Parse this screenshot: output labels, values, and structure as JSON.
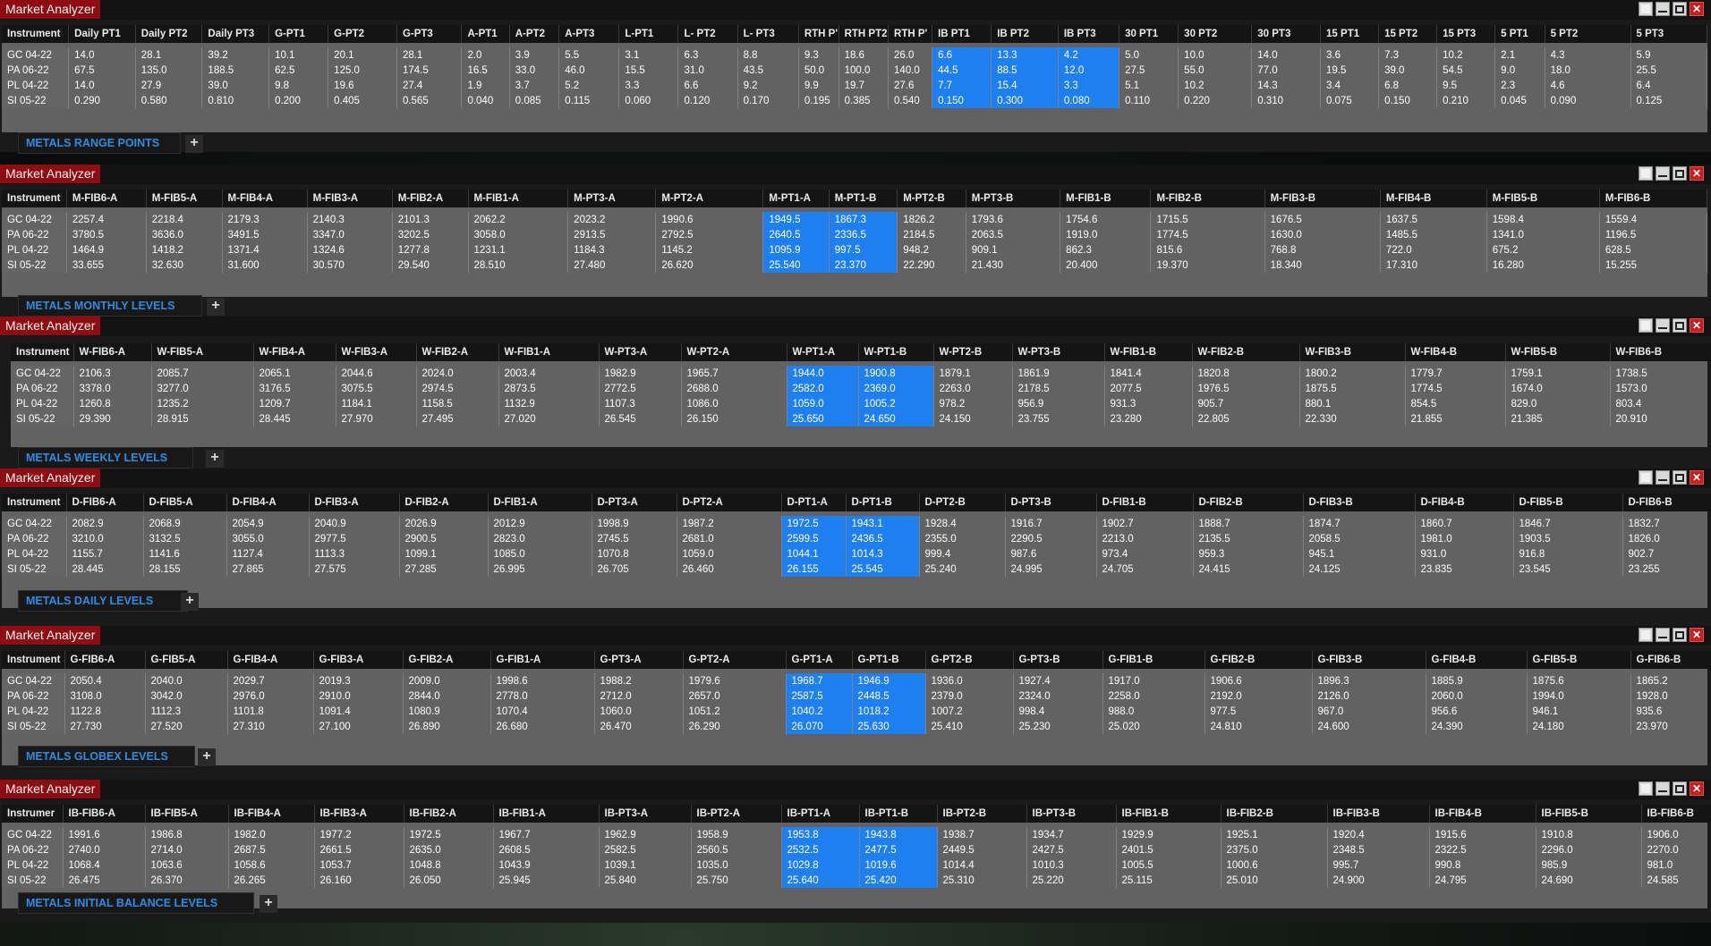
{
  "window_title": "Market Analyzer",
  "add_tab_label": "+",
  "instruments": [
    "GC 04-22",
    "PA 06-22",
    "PL 04-22",
    "SI 05-22"
  ],
  "panels": [
    {
      "tab": "METALS RANGE POINTS",
      "instrument_header": "Instrument",
      "columns": [
        "Daily PT1",
        "Daily PT2",
        "Daily PT3",
        "G-PT1",
        "G-PT2",
        "G-PT3",
        "A-PT1",
        "A-PT2",
        "A-PT3",
        "L-PT1",
        "L- PT2",
        "L- PT3",
        "RTH P'",
        "RTH PT2",
        "RTH P'",
        "IB PT1",
        "IB PT2",
        "IB PT3",
        "30 PT1",
        "30 PT2",
        "30 PT3",
        "15 PT1",
        "15 PT2",
        "15 PT3",
        "5 PT1",
        "5 PT2",
        "5 PT3"
      ],
      "highlight": [
        15,
        16,
        17
      ],
      "rows": [
        [
          "14.0",
          "28.1",
          "39.2",
          "10.1",
          "20.1",
          "28.1",
          "2.0",
          "3.9",
          "5.5",
          "3.1",
          "6.3",
          "8.8",
          "9.3",
          "18.6",
          "26.0",
          "6.6",
          "13.3",
          "4.2",
          "5.0",
          "10.0",
          "14.0",
          "3.6",
          "7.3",
          "10.2",
          "2.1",
          "4.3",
          "5.9"
        ],
        [
          "67.5",
          "135.0",
          "188.5",
          "62.5",
          "125.0",
          "174.5",
          "16.5",
          "33.0",
          "46.0",
          "15.5",
          "31.0",
          "43.5",
          "50.0",
          "100.0",
          "140.0",
          "44.5",
          "88.5",
          "12.0",
          "27.5",
          "55.0",
          "77.0",
          "19.5",
          "39.0",
          "54.5",
          "9.0",
          "18.0",
          "25.5"
        ],
        [
          "14.0",
          "27.9",
          "39.0",
          "9.8",
          "19.6",
          "27.4",
          "1.9",
          "3.7",
          "5.2",
          "3.3",
          "6.6",
          "9.2",
          "9.9",
          "19.7",
          "27.6",
          "7.7",
          "15.4",
          "3.3",
          "5.1",
          "10.2",
          "14.3",
          "3.4",
          "6.8",
          "9.5",
          "2.3",
          "4.6",
          "6.4"
        ],
        [
          "0.290",
          "0.580",
          "0.810",
          "0.200",
          "0.405",
          "0.565",
          "0.040",
          "0.085",
          "0.115",
          "0.060",
          "0.120",
          "0.170",
          "0.195",
          "0.385",
          "0.540",
          "0.150",
          "0.300",
          "0.080",
          "0.110",
          "0.220",
          "0.310",
          "0.075",
          "0.150",
          "0.210",
          "0.045",
          "0.090",
          "0.125"
        ]
      ]
    },
    {
      "tab": "METALS MONTHLY LEVELS",
      "instrument_header": "Instrument",
      "columns": [
        "M-FIB6-A",
        "M-FIB5-A",
        "M-FIB4-A",
        "M-FIB3-A",
        "M-FIB2-A",
        "M-FIB1-A",
        "M-PT3-A",
        "M-PT2-A",
        "M-PT1-A",
        "M-PT1-B",
        "M-PT2-B",
        "M-PT3-B",
        "M-FIB1-B",
        "M-FIB2-B",
        "M-FIB3-B",
        "M-FIB4-B",
        "M-FIB5-B",
        "M-FIB6-B"
      ],
      "highlight": [
        8,
        9
      ],
      "rows": [
        [
          "2257.4",
          "2218.4",
          "2179.3",
          "2140.3",
          "2101.3",
          "2062.2",
          "2023.2",
          "1990.6",
          "1949.5",
          "1867.3",
          "1826.2",
          "1793.6",
          "1754.6",
          "1715.5",
          "1676.5",
          "1637.5",
          "1598.4",
          "1559.4"
        ],
        [
          "3780.5",
          "3636.0",
          "3491.5",
          "3347.0",
          "3202.5",
          "3058.0",
          "2913.5",
          "2792.5",
          "2640.5",
          "2336.5",
          "2184.5",
          "2063.5",
          "1919.0",
          "1774.5",
          "1630.0",
          "1485.5",
          "1341.0",
          "1196.5"
        ],
        [
          "1464.9",
          "1418.2",
          "1371.4",
          "1324.6",
          "1277.8",
          "1231.1",
          "1184.3",
          "1145.2",
          "1095.9",
          "997.5",
          "948.2",
          "909.1",
          "862.3",
          "815.6",
          "768.8",
          "722.0",
          "675.2",
          "628.5"
        ],
        [
          "33.655",
          "32.630",
          "31.600",
          "30.570",
          "29.540",
          "28.510",
          "27.480",
          "26.620",
          "25.540",
          "23.370",
          "22.290",
          "21.430",
          "20.400",
          "19.370",
          "18.340",
          "17.310",
          "16.280",
          "15.255"
        ]
      ]
    },
    {
      "tab": "METALS WEEKLY LEVELS",
      "instrument_header": "Instrument",
      "columns": [
        "W-FIB6-A",
        "W-FIB5-A",
        "W-FIB4-A",
        "W-FIB3-A",
        "W-FIB2-A",
        "W-FIB1-A",
        "W-PT3-A",
        "W-PT2-A",
        "W-PT1-A",
        "W-PT1-B",
        "W-PT2-B",
        "W-PT3-B",
        "W-FIB1-B",
        "W-FIB2-B",
        "W-FIB3-B",
        "W-FIB4-B",
        "W-FIB5-B",
        "W-FIB6-B"
      ],
      "highlight": [
        8,
        9
      ],
      "rows": [
        [
          "2106.3",
          "2085.7",
          "2065.1",
          "2044.6",
          "2024.0",
          "2003.4",
          "1982.9",
          "1965.7",
          "1944.0",
          "1900.8",
          "1879.1",
          "1861.9",
          "1841.4",
          "1820.8",
          "1800.2",
          "1779.7",
          "1759.1",
          "1738.5"
        ],
        [
          "3378.0",
          "3277.0",
          "3176.5",
          "3075.5",
          "2974.5",
          "2873.5",
          "2772.5",
          "2688.0",
          "2582.0",
          "2369.0",
          "2263.0",
          "2178.5",
          "2077.5",
          "1976.5",
          "1875.5",
          "1774.5",
          "1674.0",
          "1573.0"
        ],
        [
          "1260.8",
          "1235.2",
          "1209.7",
          "1184.1",
          "1158.5",
          "1132.9",
          "1107.3",
          "1086.0",
          "1059.0",
          "1005.2",
          "978.2",
          "956.9",
          "931.3",
          "905.7",
          "880.1",
          "854.5",
          "829.0",
          "803.4"
        ],
        [
          "29.390",
          "28.915",
          "28.445",
          "27.970",
          "27.495",
          "27.020",
          "26.545",
          "26.150",
          "25.650",
          "24.650",
          "24.150",
          "23.755",
          "23.280",
          "22.805",
          "22.330",
          "21.855",
          "21.385",
          "20.910"
        ]
      ]
    },
    {
      "tab": "METALS DAILY LEVELS",
      "instrument_header": "Instrument",
      "columns": [
        "D-FIB6-A",
        "D-FIB5-A",
        "D-FIB4-A",
        "D-FIB3-A",
        "D-FIB2-A",
        "D-FIB1-A",
        "D-PT3-A",
        "D-PT2-A",
        "D-PT1-A",
        "D-PT1-B",
        "D-PT2-B",
        "D-PT3-B",
        "D-FIB1-B",
        "D-FIB2-B",
        "D-FIB3-B",
        "D-FIB4-B",
        "D-FIB5-B",
        "D-FIB6-B"
      ],
      "highlight": [
        8,
        9
      ],
      "rows": [
        [
          "2082.9",
          "2068.9",
          "2054.9",
          "2040.9",
          "2026.9",
          "2012.9",
          "1998.9",
          "1987.2",
          "1972.5",
          "1943.1",
          "1928.4",
          "1916.7",
          "1902.7",
          "1888.7",
          "1874.7",
          "1860.7",
          "1846.7",
          "1832.7"
        ],
        [
          "3210.0",
          "3132.5",
          "3055.0",
          "2977.5",
          "2900.5",
          "2823.0",
          "2745.5",
          "2681.0",
          "2599.5",
          "2436.5",
          "2355.0",
          "2290.5",
          "2213.0",
          "2135.5",
          "2058.5",
          "1981.0",
          "1903.5",
          "1826.0"
        ],
        [
          "1155.7",
          "1141.6",
          "1127.4",
          "1113.3",
          "1099.1",
          "1085.0",
          "1070.8",
          "1059.0",
          "1044.1",
          "1014.3",
          "999.4",
          "987.6",
          "973.4",
          "959.3",
          "945.1",
          "931.0",
          "916.8",
          "902.7"
        ],
        [
          "28.445",
          "28.155",
          "27.865",
          "27.575",
          "27.285",
          "26.995",
          "26.705",
          "26.460",
          "26.155",
          "25.545",
          "25.240",
          "24.995",
          "24.705",
          "24.415",
          "24.125",
          "23.835",
          "23.545",
          "23.255"
        ]
      ]
    },
    {
      "tab": "METALS GLOBEX LEVELS",
      "instrument_header": "Instrument",
      "columns": [
        "G-FIB6-A",
        "G-FIB5-A",
        "G-FIB4-A",
        "G-FIB3-A",
        "G-FIB2-A",
        "G-FIB1-A",
        "G-PT3-A",
        "G-PT2-A",
        "G-PT1-A",
        "G-PT1-B",
        "G-PT2-B",
        "G-PT3-B",
        "G-FIB1-B",
        "G-FIB2-B",
        "G-FIB3-B",
        "G-FIB4-B",
        "G-FIB5-B",
        "G-FIB6-B"
      ],
      "highlight": [
        8,
        9
      ],
      "rows": [
        [
          "2050.4",
          "2040.0",
          "2029.7",
          "2019.3",
          "2009.0",
          "1998.6",
          "1988.2",
          "1979.6",
          "1968.7",
          "1946.9",
          "1936.0",
          "1927.4",
          "1917.0",
          "1906.6",
          "1896.3",
          "1885.9",
          "1875.6",
          "1865.2"
        ],
        [
          "3108.0",
          "3042.0",
          "2976.0",
          "2910.0",
          "2844.0",
          "2778.0",
          "2712.0",
          "2657.0",
          "2587.5",
          "2448.5",
          "2379.0",
          "2324.0",
          "2258.0",
          "2192.0",
          "2126.0",
          "2060.0",
          "1994.0",
          "1928.0"
        ],
        [
          "1122.8",
          "1112.3",
          "1101.8",
          "1091.4",
          "1080.9",
          "1070.4",
          "1060.0",
          "1051.2",
          "1040.2",
          "1018.2",
          "1007.2",
          "998.4",
          "988.0",
          "977.5",
          "967.0",
          "956.6",
          "946.1",
          "935.6"
        ],
        [
          "27.730",
          "27.520",
          "27.310",
          "27.100",
          "26.890",
          "26.680",
          "26.470",
          "26.290",
          "26.070",
          "25.630",
          "25.410",
          "25.230",
          "25.020",
          "24.810",
          "24.600",
          "24.390",
          "24.180",
          "23.970"
        ]
      ]
    },
    {
      "tab": "METALS  INITIAL BALANCE LEVELS",
      "instrument_header": "Instrumer",
      "columns": [
        "IB-FIB6-A",
        "IB-FIB5-A",
        "IB-FIB4-A",
        "IB-FIB3-A",
        "IB-FIB2-A",
        "IB-FIB1-A",
        "IB-PT3-A",
        "IB-PT2-A",
        "IB-PT1-A",
        "IB-PT1-B",
        "IB-PT2-B",
        "IB-PT3-B",
        "IB-FIB1-B",
        "IB-FIB2-B",
        "IB-FIB3-B",
        "IB-FIB4-B",
        "IB-FIB5-B",
        "IB-FIB6-B"
      ],
      "highlight": [
        8,
        9
      ],
      "rows": [
        [
          "1991.6",
          "1986.8",
          "1982.0",
          "1977.2",
          "1972.5",
          "1967.7",
          "1962.9",
          "1958.9",
          "1953.8",
          "1943.8",
          "1938.7",
          "1934.7",
          "1929.9",
          "1925.1",
          "1920.4",
          "1915.6",
          "1910.8",
          "1906.0"
        ],
        [
          "2740.0",
          "2714.0",
          "2687.5",
          "2661.5",
          "2635.0",
          "2608.5",
          "2582.5",
          "2560.5",
          "2532.5",
          "2477.5",
          "2449.5",
          "2427.5",
          "2401.5",
          "2375.0",
          "2348.5",
          "2322.5",
          "2296.0",
          "2270.0"
        ],
        [
          "1068.4",
          "1063.6",
          "1058.6",
          "1053.7",
          "1048.8",
          "1043.9",
          "1039.1",
          "1035.0",
          "1029.8",
          "1019.6",
          "1014.4",
          "1010.3",
          "1005.5",
          "1000.6",
          "995.7",
          "990.8",
          "985.9",
          "981.0"
        ],
        [
          "26.475",
          "26.370",
          "26.265",
          "26.160",
          "26.050",
          "25.945",
          "25.840",
          "25.750",
          "25.640",
          "25.420",
          "25.310",
          "25.220",
          "25.115",
          "25.010",
          "24.900",
          "24.795",
          "24.690",
          "24.585"
        ]
      ]
    }
  ]
}
